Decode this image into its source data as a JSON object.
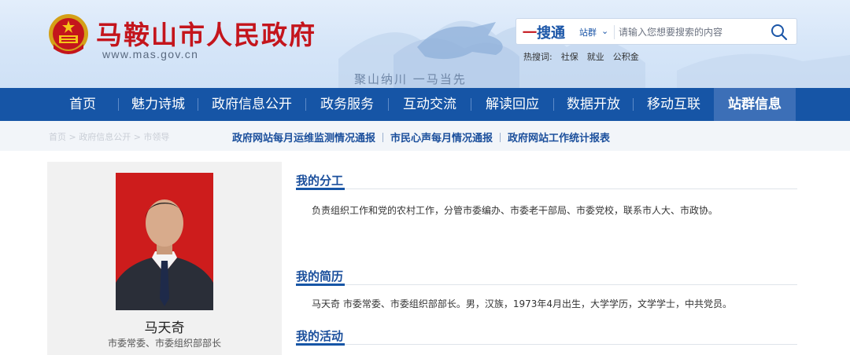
{
  "header": {
    "site_title": "马鞍山市人民政府",
    "site_url": "www.mas.gov.cn",
    "slogan": "聚山纳川  一马当先",
    "brand_color": "#1655a6",
    "accent_red": "#c4151c"
  },
  "search": {
    "brand_part1": "一",
    "brand_part2": "搜通",
    "scope": "站群",
    "placeholder": "请输入您想要搜索的内容",
    "hot_label": "热搜词:",
    "hot_terms": [
      "社保",
      "就业",
      "公积金"
    ]
  },
  "nav": {
    "items": [
      "首页",
      "魅力诗城",
      "政府信息公开",
      "政务服务",
      "互动交流",
      "解读回应",
      "数据开放",
      "移动互联",
      "站群信息"
    ],
    "active": "站群信息"
  },
  "subbar": {
    "breadcrumb": "首页 > 政府信息公开 > 市领导",
    "links": [
      "政府网站每月运维监测情况通报",
      "市民心声每月情况通报",
      "政府网站工作统计报表"
    ]
  },
  "profile": {
    "name": "马天奇",
    "title": "市委常委、市委组织部部长"
  },
  "sections": {
    "duty_title": "我的分工",
    "duty_text": "负责组织工作和党的农村工作，分管市委编办、市委老干部局、市委党校，联系市人大、市政协。",
    "resume_title": "我的简历",
    "resume_text": "马天奇  市委常委、市委组织部部长。男，汉族，1973年4月出生，大学学历，文学学士，中共党员。",
    "activity_title": "我的活动"
  }
}
